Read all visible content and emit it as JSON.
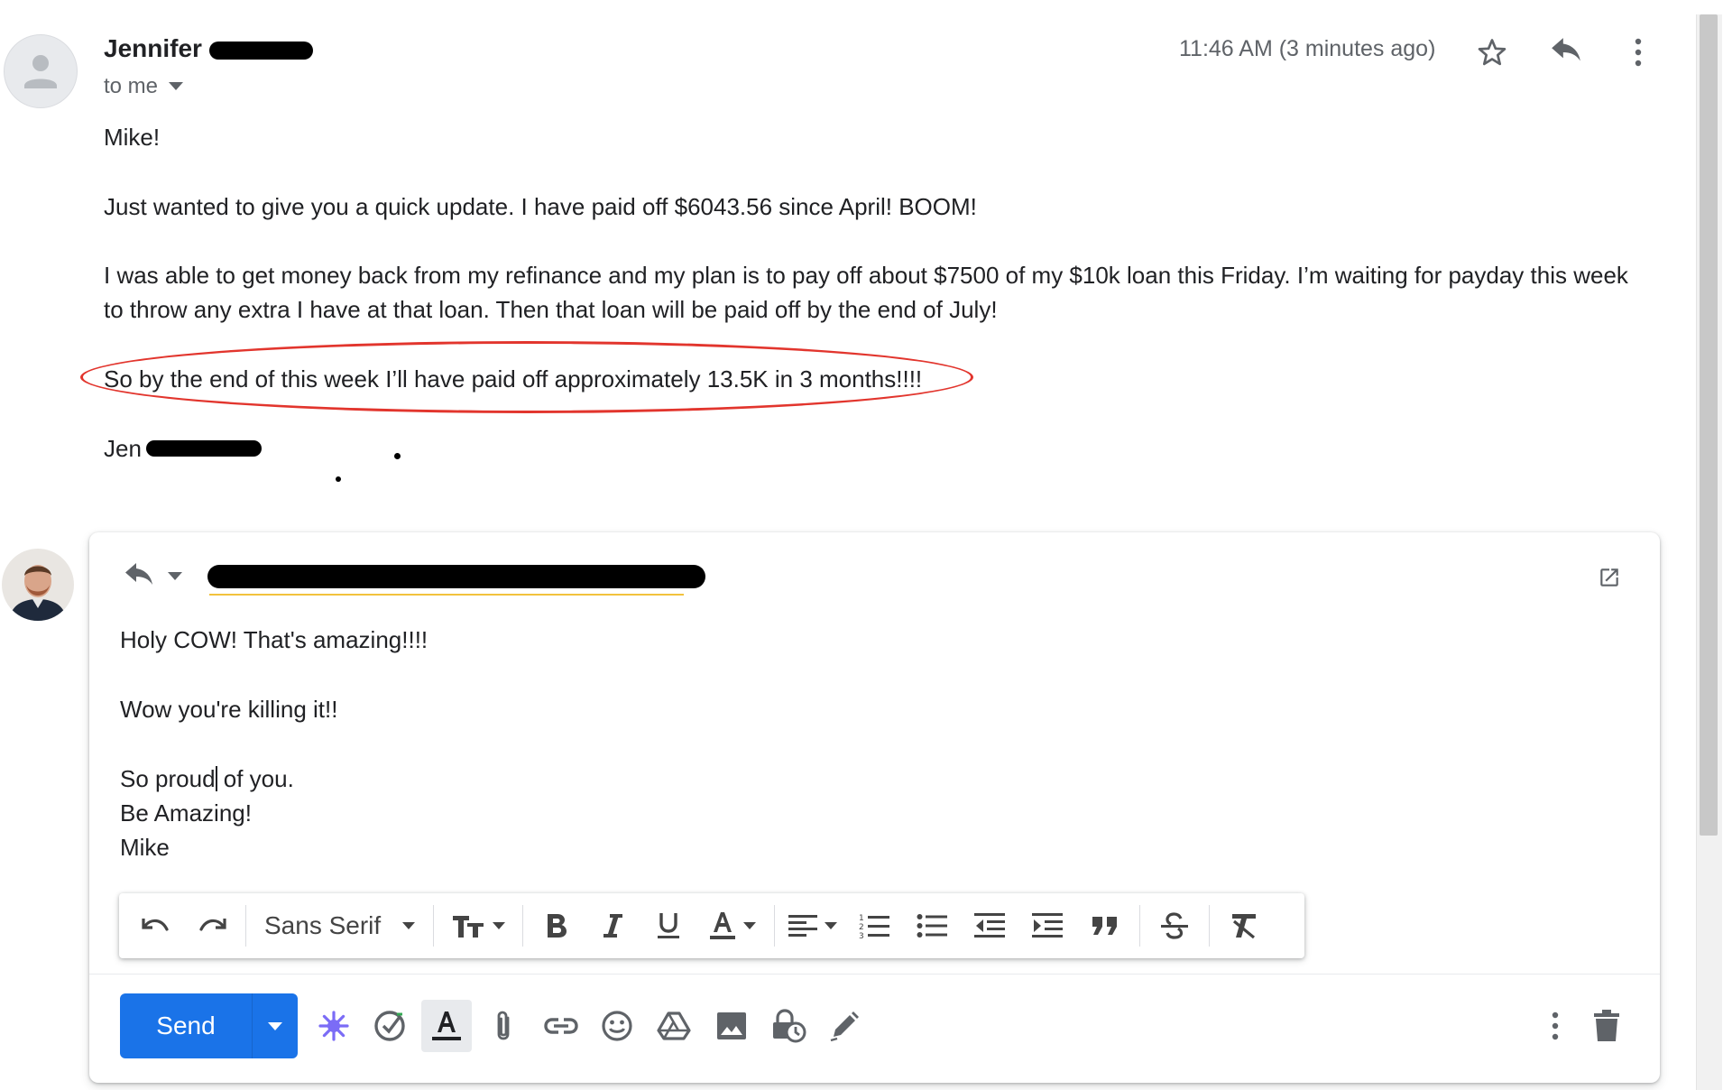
{
  "sender": {
    "name": "Jennifer",
    "recipient_label": "to me"
  },
  "message": {
    "timestamp": "11:46 AM (3 minutes ago)",
    "greeting": "Mike!",
    "para1": "Just wanted to give you a quick update. I have paid off $6043.56 since April! BOOM!",
    "para2_line1": "I was able to get money back from my refinance and my plan is to pay off about $7500 of my $10k loan this Friday. I’m waiting for payday this week",
    "para2_line2": "to throw any extra I have at that loan. Then that loan will be paid off by the end of July!",
    "highlight": "So by the end of this week I’ll have paid off approximately 13.5K in 3 months!!!!",
    "signature": "Jen"
  },
  "reply": {
    "line1": "Holy COW! That's amazing!!!!",
    "line2": "Wow you're killing it!!",
    "line3_before_cursor": "So proud",
    "line3_after_cursor": " of you.",
    "line4": "Be Amazing!",
    "line5": "Mike"
  },
  "toolbar": {
    "font": "Sans Serif"
  },
  "actions": {
    "send_label": "Send"
  },
  "colors": {
    "send": "#1a73e8",
    "highlight_oval": "#e2352d"
  }
}
